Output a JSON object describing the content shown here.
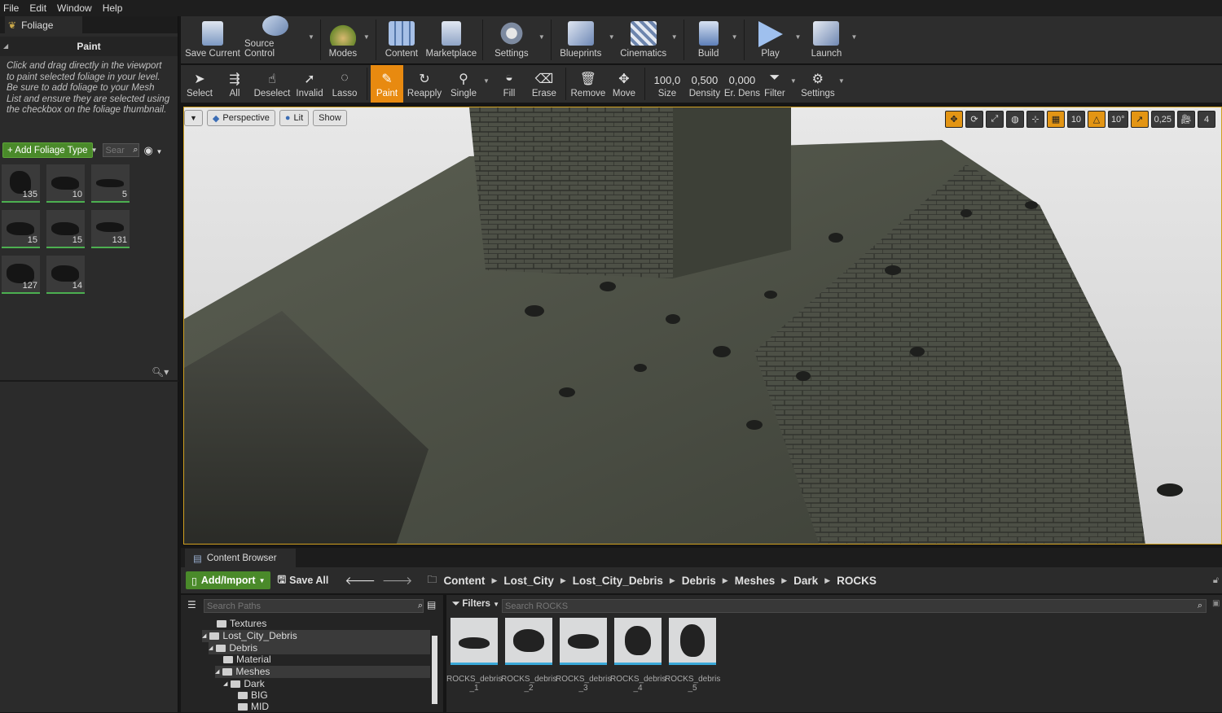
{
  "menu": [
    "File",
    "Edit",
    "Window",
    "Help"
  ],
  "foliage_panel": {
    "tab_title": "Foliage",
    "section_title": "Paint",
    "help_text": "Click and drag directly in the viewport to paint selected foliage in your level. Be sure to add foliage to your Mesh List and ensure they are selected using the checkbox on the foliage thumbnail.",
    "add_button": "+ Add Foliage Type",
    "search_placeholder": "Sear",
    "thumbnails": [
      {
        "count": "135"
      },
      {
        "count": "10"
      },
      {
        "count": "5"
      },
      {
        "count": "15"
      },
      {
        "count": "15"
      },
      {
        "count": "131"
      },
      {
        "count": "127"
      },
      {
        "count": "14"
      }
    ]
  },
  "main_toolbar": [
    {
      "label": "Save Current",
      "icon": "save-icon"
    },
    {
      "label": "Source Control",
      "icon": "source-control-icon"
    },
    {
      "label": "Modes",
      "icon": "modes-icon"
    },
    {
      "label": "Content",
      "icon": "content-icon"
    },
    {
      "label": "Marketplace",
      "icon": "marketplace-icon"
    },
    {
      "label": "Settings",
      "icon": "settings-icon"
    },
    {
      "label": "Blueprints",
      "icon": "blueprints-icon"
    },
    {
      "label": "Cinematics",
      "icon": "cinematics-icon"
    },
    {
      "label": "Build",
      "icon": "build-icon"
    },
    {
      "label": "Play",
      "icon": "play-icon"
    },
    {
      "label": "Launch",
      "icon": "launch-icon"
    }
  ],
  "foliage_toolbar": {
    "select": "Select",
    "all": "All",
    "deselect": "Deselect",
    "invalid": "Invalid",
    "lasso": "Lasso",
    "paint": "Paint",
    "reapply": "Reapply",
    "single": "Single",
    "fill": "Fill",
    "erase": "Erase",
    "remove": "Remove",
    "move": "Move",
    "size_value": "100,0",
    "size_label": "Size",
    "density_value": "0,500",
    "density_label": "Density",
    "erdens_value": "0,000",
    "erdens_label": "Er. Dens",
    "filter": "Filter",
    "settings": "Settings"
  },
  "viewport": {
    "perspective": "Perspective",
    "lit": "Lit",
    "show": "Show",
    "grid_snap": "10",
    "rot_snap": "10°",
    "scale_snap": "0,25",
    "camera_speed": "4"
  },
  "content_browser": {
    "tab_title": "Content Browser",
    "add_import": "Add/Import",
    "save_all": "Save All",
    "breadcrumbs": [
      "Content",
      "Lost_City",
      "Lost_City_Debris",
      "Debris",
      "Meshes",
      "Dark",
      "ROCKS"
    ],
    "search_paths_placeholder": "Search Paths",
    "filters": "Filters",
    "search_assets_placeholder": "Search ROCKS",
    "tree": [
      "Textures",
      "Lost_City_Debris",
      "Debris",
      "Material",
      "Meshes",
      "Dark",
      "BIG",
      "MID"
    ],
    "assets": [
      {
        "line1": "ROCKS_debris",
        "line2": "_1"
      },
      {
        "line1": "ROCKS_debris",
        "line2": "_2"
      },
      {
        "line1": "ROCKS_debris",
        "line2": "_3"
      },
      {
        "line1": "ROCKS_debris",
        "line2": "_4"
      },
      {
        "line1": "ROCKS_debris",
        "line2": "_5"
      }
    ]
  },
  "colors": {
    "accent_orange": "#e88a10",
    "accent_green": "#4a8a2a",
    "selection_blue": "#3aa8d8"
  }
}
